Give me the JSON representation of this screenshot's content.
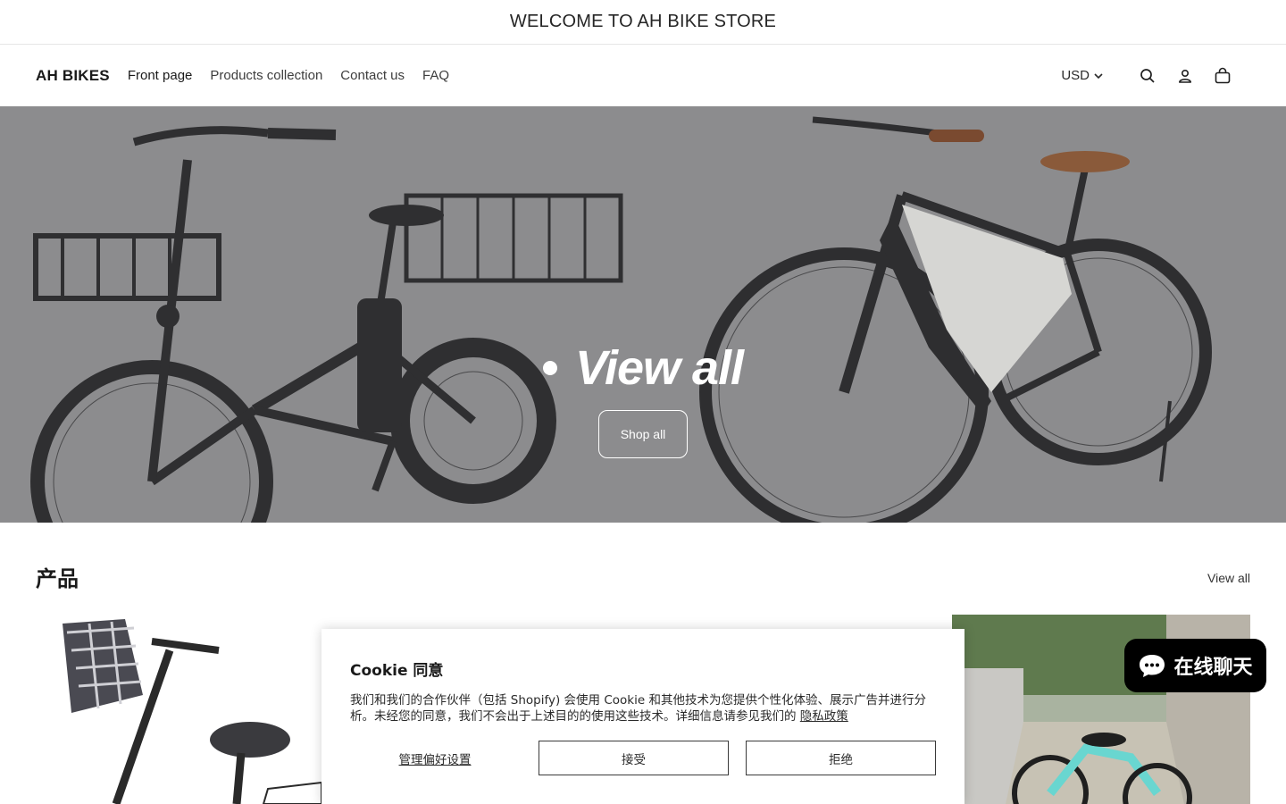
{
  "announcement": {
    "text": "WELCOME TO AH BIKE STORE"
  },
  "header": {
    "logo": "AH BIKES",
    "nav": [
      {
        "label": "Front page"
      },
      {
        "label": "Products collection"
      },
      {
        "label": "Contact us"
      },
      {
        "label": "FAQ"
      }
    ],
    "currency": "USD",
    "icons": [
      "search-icon",
      "account-icon",
      "cart-icon"
    ]
  },
  "hero": {
    "title": "View all",
    "button_label": "Shop all"
  },
  "products": {
    "heading": "产品",
    "view_all_label": "View all"
  },
  "cookie_banner": {
    "title": "Cookie 同意",
    "body": "我们和我们的合作伙伴（包括 Shopify) 会使用 Cookie 和其他技术为您提供个性化体验、展示广告并进行分析。未经您的同意，我们不会出于上述目的的使用这些技术。详细信息请参见我们的",
    "privacy_link": "隐私政策",
    "manage_label": "管理偏好设置",
    "accept_label": "接受",
    "decline_label": "拒绝"
  },
  "chat": {
    "label": "在线聊天",
    "icon": "chat-bubble-icon"
  },
  "colors": {
    "hero_overlay": "#8c8c8e",
    "chat_bg": "#000000"
  }
}
